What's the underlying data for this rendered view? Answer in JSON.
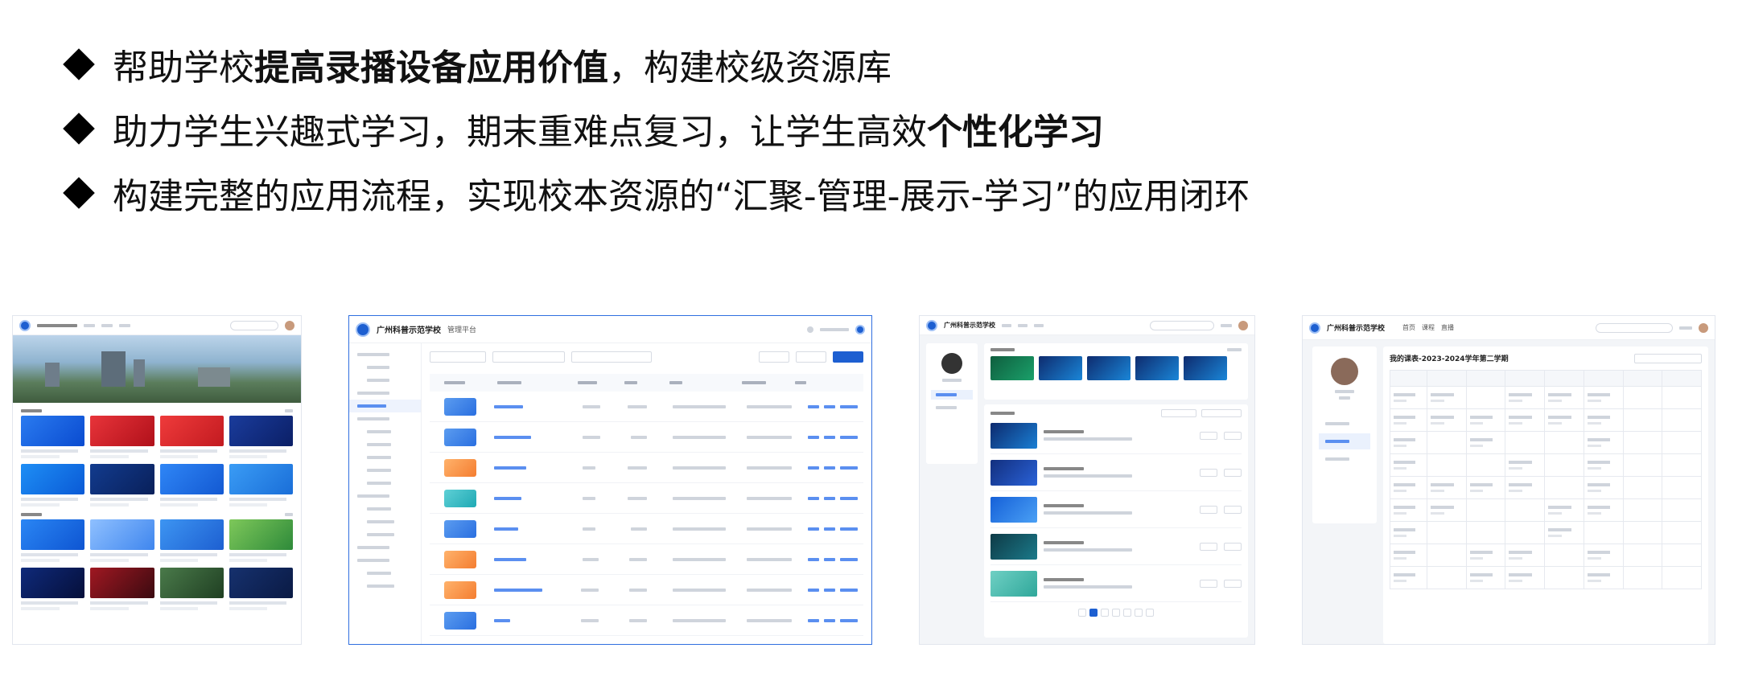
{
  "bullets": [
    {
      "pre": "帮助学校",
      "bold": "提高录播设备应用价值",
      "post": "，构建校级资源库"
    },
    {
      "pre": "助力学生兴趣式学习，期末重难点复习，让学生高效",
      "bold": "个性化学习",
      "post": ""
    },
    {
      "pre": "构建完整的应用流程，实现校本资源的“汇聚-管理-展示-学习”的应用闭环",
      "bold": "",
      "post": ""
    }
  ],
  "screens": {
    "s2": {
      "title": "广州科普示范学校",
      "section": "管理平台"
    },
    "s3": {
      "school": "广州科普示范学校"
    },
    "s4": {
      "school": "广州科普示范学校",
      "tabs": [
        "首页",
        "课程",
        "直播"
      ],
      "term_title": "我的课表-2023-2024学年第二学期"
    }
  }
}
